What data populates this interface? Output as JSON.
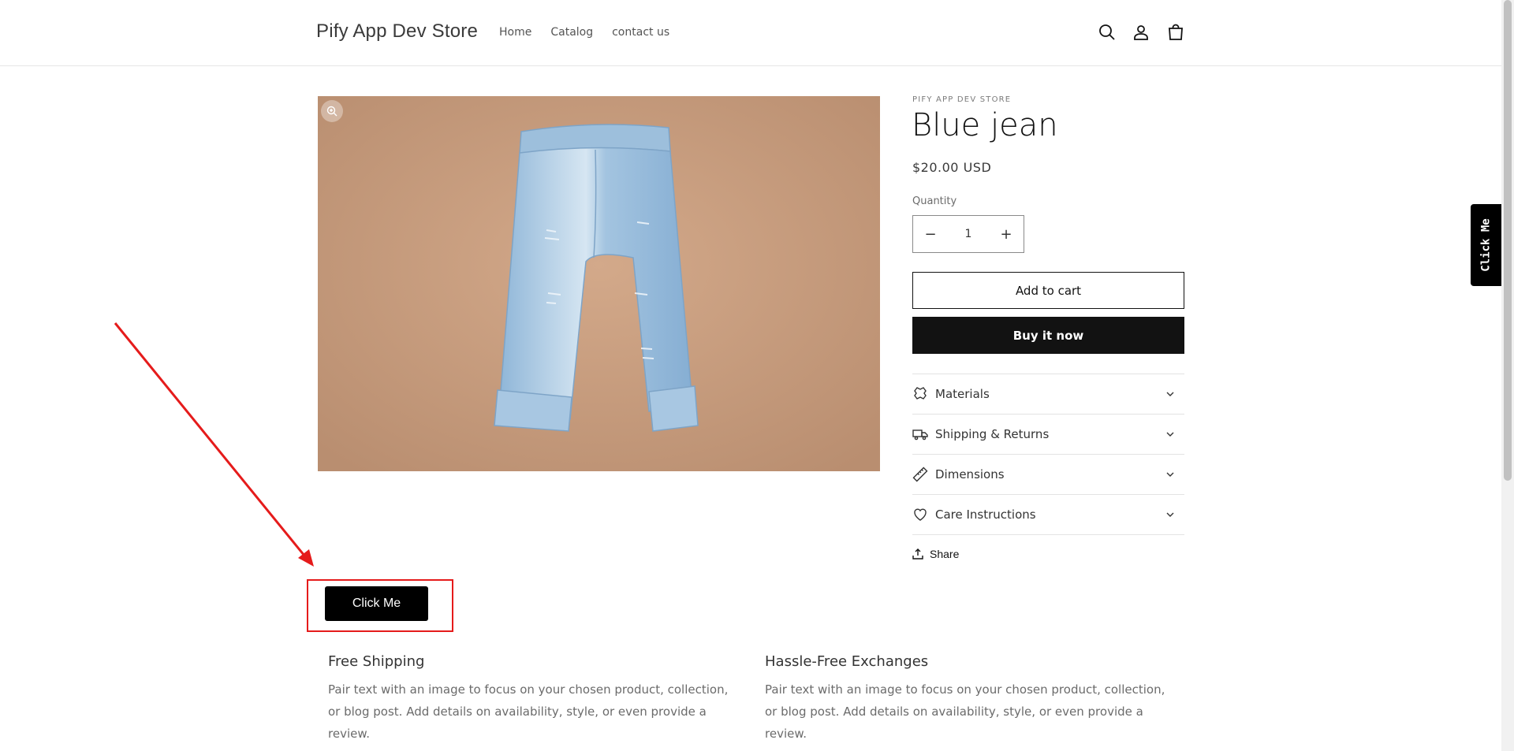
{
  "header": {
    "store_name": "Pify App Dev Store",
    "nav": [
      "Home",
      "Catalog",
      "contact us"
    ],
    "icons": [
      "search-icon",
      "account-icon",
      "cart-icon"
    ]
  },
  "product": {
    "vendor": "PIFY APP DEV STORE",
    "title": "Blue jean",
    "price": "$20.00 USD",
    "quantity_label": "Quantity",
    "quantity_value": "1",
    "minus": "−",
    "plus": "+",
    "add_to_cart": "Add to cart",
    "buy_now": "Buy it now",
    "accordions": [
      {
        "label": "Materials",
        "icon": "materials-icon"
      },
      {
        "label": "Shipping & Returns",
        "icon": "truck-icon"
      },
      {
        "label": "Dimensions",
        "icon": "ruler-icon"
      },
      {
        "label": "Care Instructions",
        "icon": "heart-icon"
      }
    ],
    "share": "Share"
  },
  "click_me": {
    "label": "Click Me",
    "side_tab": "Click Me",
    "highlight_color": "#e51b1b"
  },
  "features": [
    {
      "title": "Free Shipping",
      "text": "Pair text with an image to focus on your chosen product, collection, or blog post. Add details on availability, style, or even provide a review."
    },
    {
      "title": "Hassle-Free Exchanges",
      "text": "Pair text with an image to focus on your chosen product, collection, or blog post. Add details on availability, style, or even provide a review."
    }
  ],
  "colors": {
    "accent": "#121212",
    "image_bg": "#c49a7c",
    "jeans": "#a9c8e3"
  }
}
